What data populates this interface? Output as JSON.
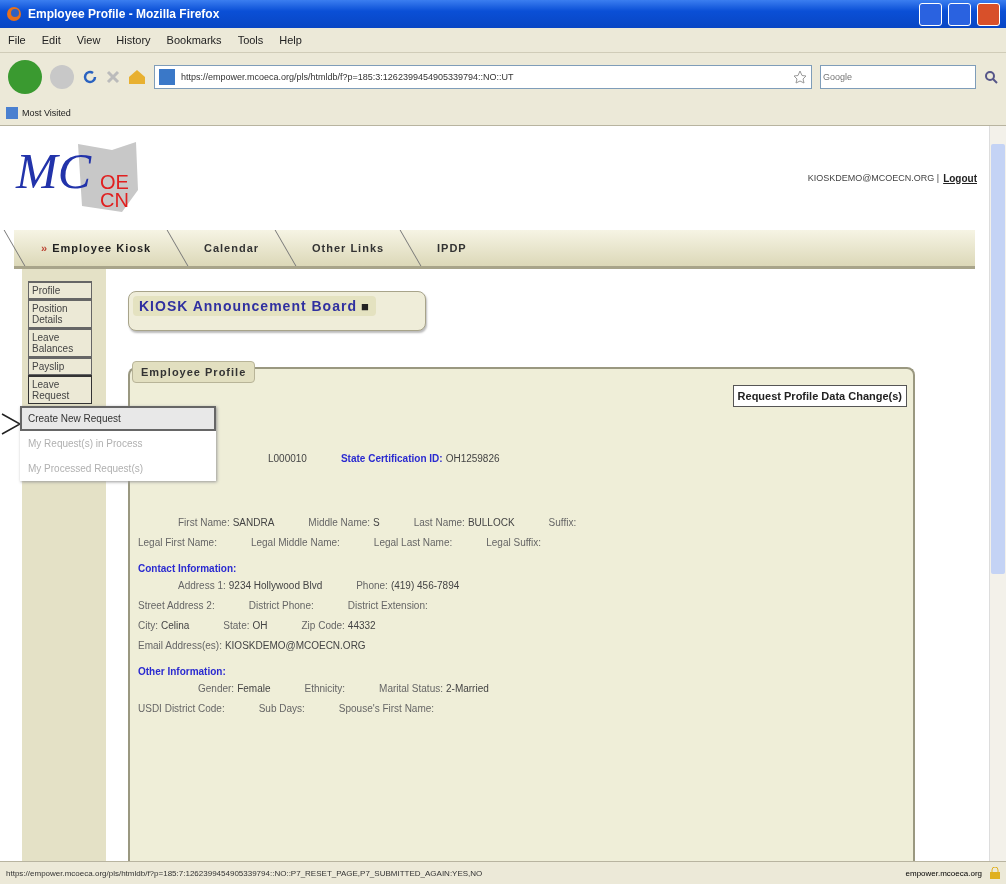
{
  "window": {
    "title": "Employee Profile - Mozilla Firefox"
  },
  "menu": [
    "File",
    "Edit",
    "View",
    "History",
    "Bookmarks",
    "Tools",
    "Help"
  ],
  "nav": {
    "url": "https://empower.mcoeca.org/pls/htmldb/f?p=185:3:1262399454905339794::NO::UT",
    "search_placeholder": "Google"
  },
  "bookmarks": [
    "Most Visited"
  ],
  "header": {
    "logo": {
      "initials": "MC",
      "mark_top": "OE",
      "mark_bottom": "CN"
    },
    "user": "KIOSKDEMO@MCOECN.ORG |",
    "logout": "Logout"
  },
  "tabs": [
    {
      "label": "Employee Kiosk",
      "marker": "»",
      "selected": true
    },
    {
      "label": "Calendar",
      "selected": false
    },
    {
      "label": "Other Links",
      "selected": false
    },
    {
      "label": "IPDP",
      "selected": false
    }
  ],
  "sidebar": [
    {
      "label": "Profile"
    },
    {
      "label": "Position Details"
    },
    {
      "label": "Leave Balances"
    },
    {
      "label": "Payslip"
    },
    {
      "label": "Leave Request",
      "expanded": true
    }
  ],
  "dropdown": [
    {
      "label": "Create New Request",
      "selected": true,
      "disabled": false
    },
    {
      "label": "My Request(s) in Process",
      "selected": false,
      "disabled": true
    },
    {
      "label": "My Processed Request(s)",
      "selected": false,
      "disabled": true
    }
  ],
  "announcement": {
    "title": "KIOSK Announcement Board",
    "collapse_icon": "■"
  },
  "profile": {
    "title": "Employee Profile",
    "button": "Request Profile Data Change(s)",
    "sections": [
      {
        "rows": [
          [
            {
              "value": "L000010"
            },
            {
              "label": "State Certification ID:",
              "value": "OH1259826",
              "link": true
            }
          ]
        ]
      },
      {
        "rows": [
          [
            {
              "label": "First Name:",
              "value": "SANDRA"
            },
            {
              "label": "Middle Name:",
              "value": "S"
            },
            {
              "label": "Last Name:",
              "value": "BULLOCK"
            },
            {
              "label": "Suffix:"
            }
          ],
          [
            {
              "label": "Legal First Name:"
            },
            {
              "label": "Legal Middle Name:"
            },
            {
              "label": "Legal Last Name:"
            },
            {
              "label": "Legal Suffix:"
            }
          ]
        ]
      },
      {
        "heading": "Contact Information:",
        "rows": [
          [
            {
              "label": "Address 1:",
              "value": "9234 Hollywood Blvd"
            },
            {
              "label": "Phone:",
              "value": "(419) 456-7894"
            }
          ],
          [
            {
              "label": "Street Address 2:"
            },
            {
              "label": "District Phone:"
            },
            {
              "label": "District Extension:"
            }
          ],
          [
            {
              "label": "City:",
              "value": "Celina"
            },
            {
              "label": "State:",
              "value": "OH"
            },
            {
              "label": "Zip Code:",
              "value": "44332"
            }
          ],
          [
            {
              "label": "Email Address(es):",
              "value": "KIOSKDEMO@MCOECN.ORG"
            }
          ]
        ]
      },
      {
        "heading": "Other Information:",
        "rows": [
          [
            {
              "label": "Gender:",
              "value": "Female"
            },
            {
              "label": "Ethnicity:"
            },
            {
              "label": "Marital Status:",
              "value": "2-Married"
            }
          ],
          [
            {
              "label": "USDI District Code:"
            },
            {
              "label": "Sub Days:"
            },
            {
              "label": "Spouse's First Name:"
            }
          ]
        ]
      }
    ]
  },
  "status_bar": {
    "url": "https://empower.mcoeca.org/pls/htmldb/f?p=185:7:1262399454905339794::NO::P7_RESET_PAGE,P7_SUBMITTED_AGAIN:YES,NO",
    "host": "empower.mcoeca.org"
  }
}
